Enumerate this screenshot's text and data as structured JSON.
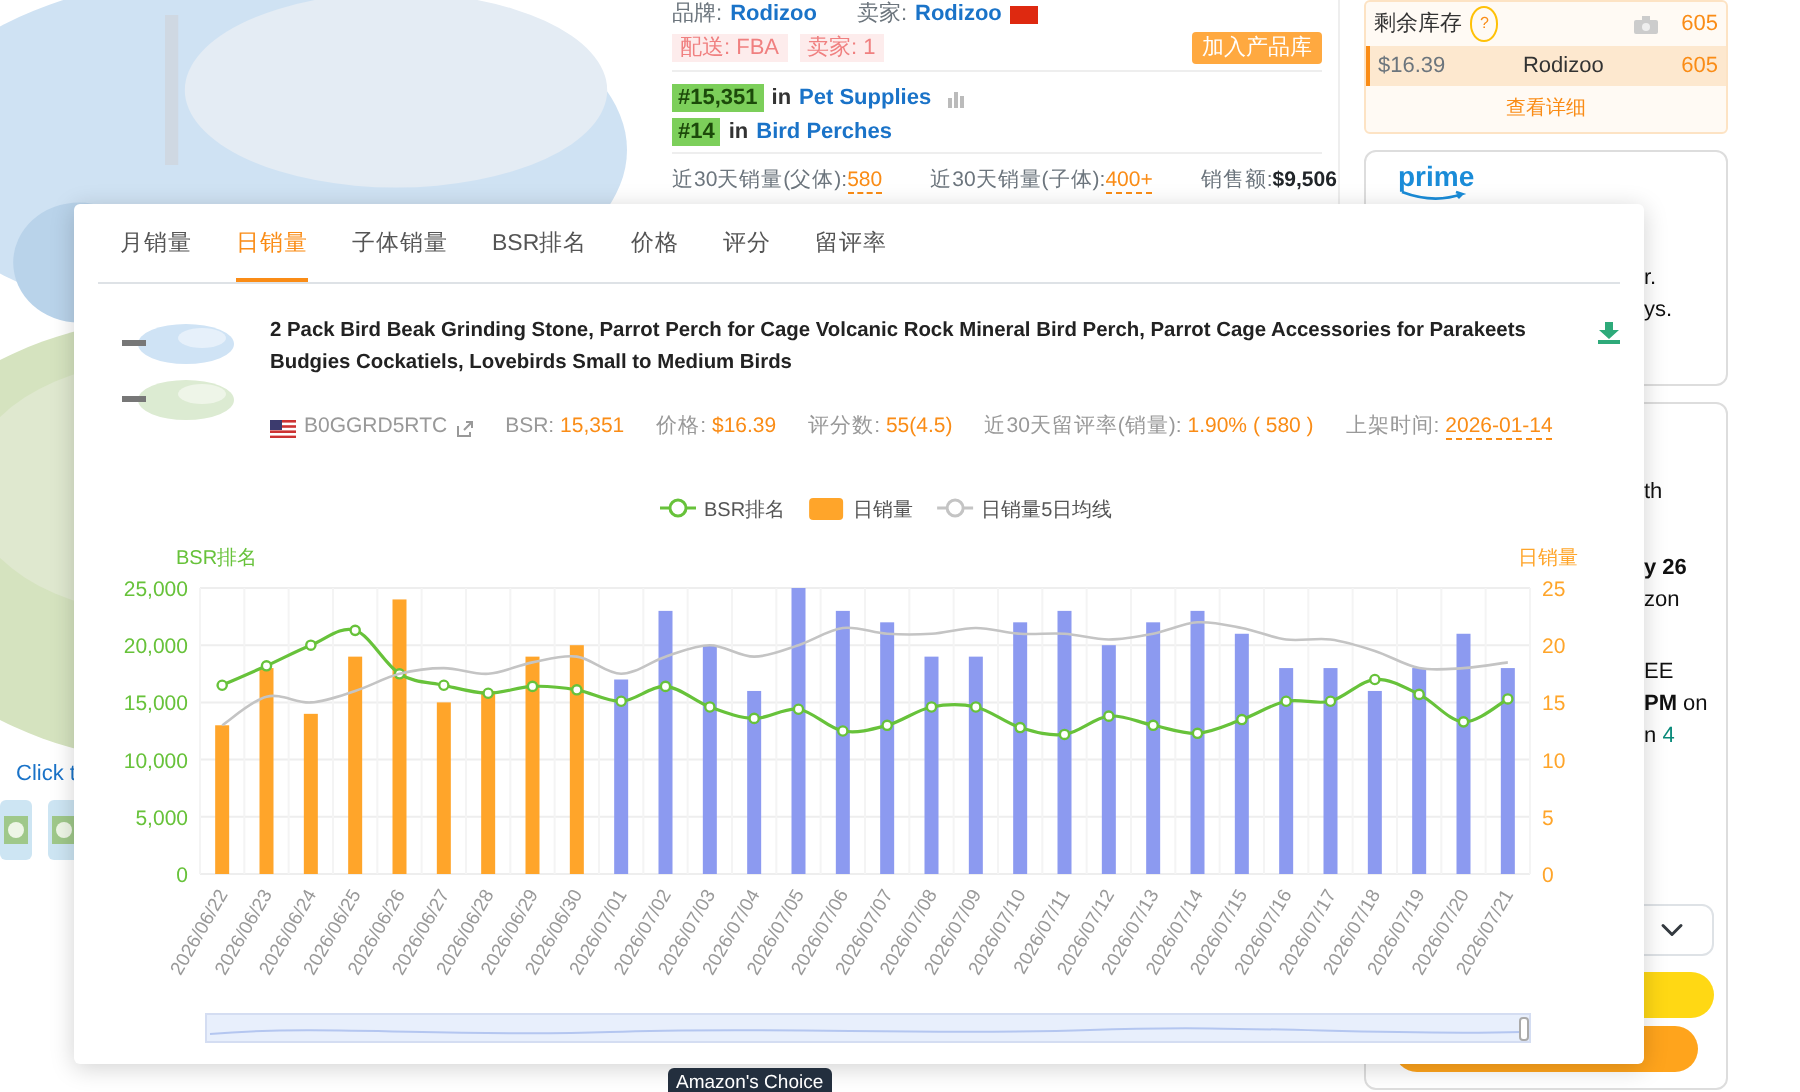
{
  "background": {
    "gallery": {
      "caption": "Click t"
    },
    "info": {
      "brand_label": "品牌:",
      "brand": "Rodizoo",
      "seller_label": "卖家:",
      "seller": "Rodizoo",
      "tags": [
        "配送: FBA",
        "卖家: 1"
      ],
      "add_button": "加入产品库",
      "ranks": [
        {
          "rank": "#15,351",
          "in": "in",
          "category": "Pet Supplies"
        },
        {
          "rank": "#14",
          "in": "in",
          "category": "Bird Perches"
        }
      ],
      "stats": [
        {
          "label": "近30天销量(父体):",
          "value": "580",
          "kind": "accent"
        },
        {
          "label": "近30天销量(子体):",
          "value": "400+",
          "kind": "accent"
        },
        {
          "label": "销售额:",
          "value": "$9,506",
          "kind": "plain"
        }
      ]
    },
    "stock": {
      "label": "剩余库存",
      "help": "?",
      "total": "605",
      "offers": [
        {
          "price": "$16.39",
          "seller": "Rodizoo",
          "qty": "605",
          "selected": true
        }
      ],
      "more": "查看详细"
    },
    "prime_card": {
      "logo": "prime",
      "lines": [
        {
          "text": "r."
        },
        {
          "text": "ys."
        }
      ]
    },
    "delivery_card": {
      "lines": [
        {
          "text": "th",
          "bold": false
        },
        {
          "text": "y 26",
          "bold": true
        },
        {
          "text": "zon",
          "bold": false
        },
        {
          "text": "EE",
          "bold": false
        },
        {
          "text": "**PM** on",
          "bold": false
        },
        {
          "text": "n ",
          "accent": "4",
          "bold": false
        }
      ]
    },
    "badge": "Amazon's Choice"
  },
  "modal": {
    "tabs": [
      {
        "label": "月销量",
        "selected": false
      },
      {
        "label": "日销量",
        "selected": true
      },
      {
        "label": "子体销量",
        "selected": false
      },
      {
        "label": "BSR排名",
        "selected": false
      },
      {
        "label": "价格",
        "selected": false
      },
      {
        "label": "评分",
        "selected": false
      },
      {
        "label": "留评率",
        "selected": false
      }
    ],
    "product": {
      "title": "2 Pack Bird Beak Grinding Stone, Parrot Perch for Cage Volcanic Rock Mineral Bird Perch, Parrot Cage Accessories for Parakeets Budgies Cockatiels, Lovebirds Small to Medium Birds",
      "asin": "B0GGRD5RTC",
      "facts": [
        {
          "label": "BSR:",
          "value": "15,351",
          "kind": "plain"
        },
        {
          "label": "价格:",
          "value": "$16.39",
          "kind": "plain"
        },
        {
          "label": "评分数:",
          "value": "55(4.5)",
          "kind": "plain"
        },
        {
          "label": "近30天留评率(销量):",
          "value": "1.90% ( 580 )",
          "kind": "plain"
        },
        {
          "label": "上架时间:",
          "value": "2026-01-14",
          "kind": "dashed"
        }
      ]
    },
    "chart_data": {
      "type": "bar",
      "ylabel": "BSR排名",
      "y2label": "日销量",
      "categories": [
        "2026/06/22",
        "2026/06/23",
        "2026/06/24",
        "2026/06/25",
        "2026/06/26",
        "2026/06/27",
        "2026/06/28",
        "2026/06/29",
        "2026/06/30",
        "2026/07/01",
        "2026/07/02",
        "2026/07/03",
        "2026/07/04",
        "2026/07/05",
        "2026/07/06",
        "2026/07/07",
        "2026/07/08",
        "2026/07/09",
        "2026/07/10",
        "2026/07/11",
        "2026/07/12",
        "2026/07/13",
        "2026/07/14",
        "2026/07/15",
        "2026/07/16",
        "2026/07/17",
        "2026/07/18",
        "2026/07/19",
        "2026/07/20",
        "2026/07/21"
      ],
      "grid": true,
      "legend": true,
      "ylim": [
        0,
        25000
      ],
      "yticks": [
        {
          "value": 0,
          "label": "0"
        },
        {
          "value": 5000,
          "label": "5,000"
        },
        {
          "value": 10000,
          "label": "10,000"
        },
        {
          "value": 15000,
          "label": "15,000"
        },
        {
          "value": 20000,
          "label": "20,000"
        },
        {
          "value": 25000,
          "label": "25,000"
        }
      ],
      "y2lim": [
        0,
        25
      ],
      "y2ticks": [
        0,
        5,
        10,
        15,
        20,
        25
      ],
      "series": [
        {
          "name": "BSR排名",
          "color": "#67c23a",
          "type": "line",
          "marker": "circle",
          "values": [
            16500,
            18200,
            20000,
            21300,
            17500,
            16500,
            15800,
            16400,
            16100,
            15100,
            16400,
            14600,
            13600,
            14400,
            12500,
            13000,
            14600,
            14600,
            12800,
            12200,
            13800,
            13000,
            12300,
            13500,
            15100,
            15100,
            17000,
            15700,
            13300,
            15300
          ]
        },
        {
          "name": "日销量",
          "color": "#ffa52a",
          "type": "bar",
          "axis": "y2",
          "values": [
            13,
            18,
            14,
            19,
            24,
            15,
            16,
            19,
            20,
            null,
            null,
            null,
            null,
            null,
            null,
            null,
            null,
            null,
            null,
            null,
            null,
            null,
            null,
            null,
            null,
            null,
            null,
            null,
            null,
            null
          ]
        },
        {
          "color": "#8c9af0",
          "type": "bar",
          "axis": "y2",
          "values": [
            null,
            null,
            null,
            null,
            null,
            null,
            null,
            null,
            null,
            17,
            23,
            20,
            16,
            25,
            23,
            22,
            19,
            19,
            22,
            23,
            20,
            22,
            23,
            21,
            18,
            18,
            16,
            18,
            21,
            18
          ]
        },
        {
          "name": "日销量5日均线",
          "color": "#c4c4c4",
          "type": "line",
          "axis": "y2",
          "values": [
            13,
            15.5,
            15,
            16,
            17.5,
            18,
            17.5,
            18.5,
            19,
            17.5,
            19,
            20,
            19,
            20,
            21.5,
            21,
            21,
            21.5,
            21,
            21,
            20.5,
            21,
            22,
            21.5,
            20.5,
            20.5,
            19.5,
            18,
            18,
            18.5
          ]
        }
      ]
    }
  }
}
